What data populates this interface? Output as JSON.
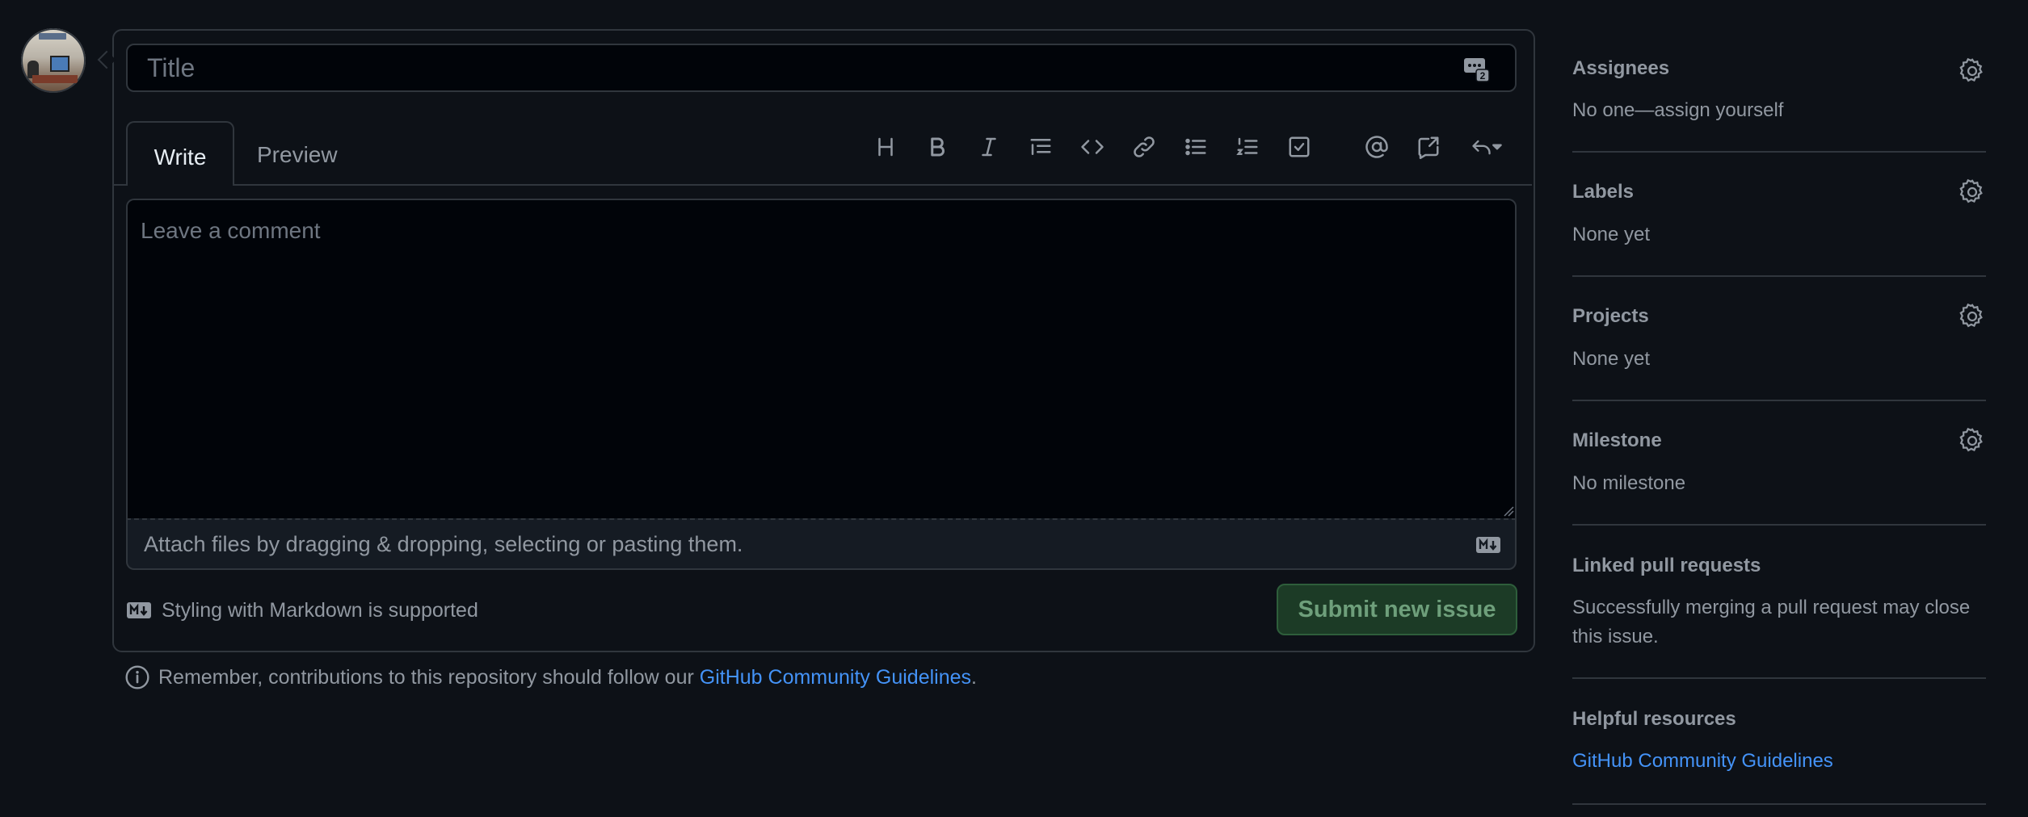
{
  "form": {
    "title_placeholder": "Title",
    "saved_replies_count": "2",
    "tabs": {
      "write": "Write",
      "preview": "Preview"
    },
    "toolbar": [
      "heading-icon",
      "bold-icon",
      "italic-icon",
      "quote-icon",
      "code-icon",
      "link-icon",
      "unordered-list-icon",
      "ordered-list-icon",
      "task-list-icon",
      "mention-icon",
      "cross-reference-icon",
      "saved-replies-icon"
    ],
    "comment_placeholder": "Leave a comment",
    "attach_text": "Attach files by dragging & dropping, selecting or pasting them.",
    "markdown_note": "Styling with Markdown is supported",
    "submit_label": "Submit new issue"
  },
  "footer": {
    "remember_text": "Remember, contributions to this repository should follow our ",
    "guidelines_link": "GitHub Community Guidelines",
    "period": "."
  },
  "sidebar": {
    "assignees": {
      "title": "Assignees",
      "value": "No one—assign yourself"
    },
    "labels": {
      "title": "Labels",
      "value": "None yet"
    },
    "projects": {
      "title": "Projects",
      "value": "None yet"
    },
    "milestone": {
      "title": "Milestone",
      "value": "No milestone"
    },
    "linked_prs": {
      "title": "Linked pull requests",
      "value": "Successfully merging a pull request may close this issue."
    },
    "helpful": {
      "title": "Helpful resources",
      "link": "GitHub Community Guidelines"
    }
  },
  "colors": {
    "background": "#0d1117",
    "border": "#30363d",
    "link": "#4493f8",
    "submit_bg": "#1c3b26"
  }
}
